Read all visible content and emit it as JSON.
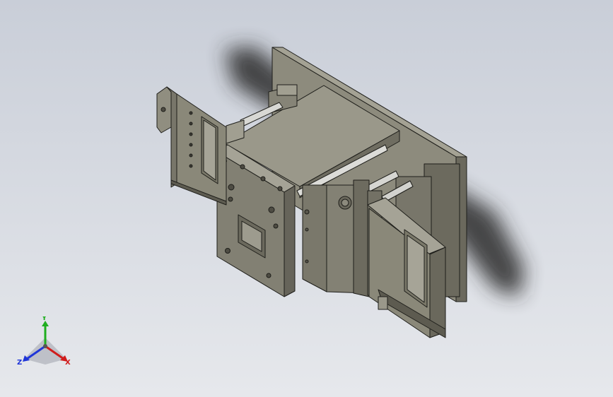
{
  "viewport": {
    "background_top": "#c9ced8",
    "background_bottom": "#e6e8ec",
    "model_face_color": "#7f7d70",
    "model_edge_color": "#1e1e1a"
  },
  "triad": {
    "x_label": "X",
    "y_label": "Y",
    "z_label": "Z",
    "x_color": "#d01c1c",
    "y_color": "#1fae1f",
    "z_color": "#2036d8"
  }
}
